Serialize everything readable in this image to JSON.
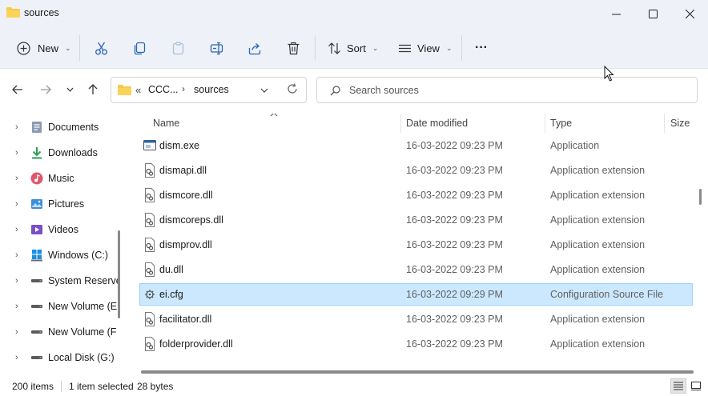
{
  "window": {
    "title": "sources",
    "minimize": "minimize",
    "maximize": "maximize",
    "close": "close"
  },
  "toolbar": {
    "new_label": "New",
    "sort_label": "Sort",
    "view_label": "View",
    "more_label": "···"
  },
  "address": {
    "overflow": "«",
    "crumbs": [
      "CCC...",
      "sources"
    ]
  },
  "search": {
    "placeholder": "Search sources"
  },
  "sidebar": {
    "items": [
      {
        "label": "Documents",
        "icon": "documents-icon"
      },
      {
        "label": "Downloads",
        "icon": "downloads-icon"
      },
      {
        "label": "Music",
        "icon": "music-icon"
      },
      {
        "label": "Pictures",
        "icon": "pictures-icon"
      },
      {
        "label": "Videos",
        "icon": "videos-icon"
      },
      {
        "label": "Windows (C:)",
        "icon": "windows-drive-icon"
      },
      {
        "label": "System Reserve",
        "icon": "drive-icon"
      },
      {
        "label": "New Volume (E",
        "icon": "drive-icon"
      },
      {
        "label": "New Volume (F",
        "icon": "drive-icon"
      },
      {
        "label": "Local Disk (G:)",
        "icon": "drive-icon"
      }
    ]
  },
  "columns": {
    "name": "Name",
    "date": "Date modified",
    "type": "Type",
    "size": "Size"
  },
  "files": [
    {
      "name": "dism.exe",
      "date": "16-03-2022 09:23 PM",
      "type": "Application",
      "icon": "exe-icon",
      "selected": false
    },
    {
      "name": "dismapi.dll",
      "date": "16-03-2022 09:23 PM",
      "type": "Application extension",
      "icon": "dll-icon",
      "selected": false
    },
    {
      "name": "dismcore.dll",
      "date": "16-03-2022 09:23 PM",
      "type": "Application extension",
      "icon": "dll-icon",
      "selected": false
    },
    {
      "name": "dismcoreps.dll",
      "date": "16-03-2022 09:23 PM",
      "type": "Application extension",
      "icon": "dll-icon",
      "selected": false
    },
    {
      "name": "dismprov.dll",
      "date": "16-03-2022 09:23 PM",
      "type": "Application extension",
      "icon": "dll-icon",
      "selected": false
    },
    {
      "name": "du.dll",
      "date": "16-03-2022 09:23 PM",
      "type": "Application extension",
      "icon": "dll-icon",
      "selected": false
    },
    {
      "name": "ei.cfg",
      "date": "16-03-2022 09:29 PM",
      "type": "Configuration Source File",
      "icon": "cfg-icon",
      "selected": true
    },
    {
      "name": "facilitator.dll",
      "date": "16-03-2022 09:23 PM",
      "type": "Application extension",
      "icon": "dll-icon",
      "selected": false
    },
    {
      "name": "folderprovider.dll",
      "date": "16-03-2022 09:23 PM",
      "type": "Application extension",
      "icon": "dll-icon",
      "selected": false
    }
  ],
  "status": {
    "count": "200 items",
    "selection": "1 item selected",
    "size": "28 bytes"
  },
  "colors": {
    "accent": "#0067c0",
    "selection_bg": "#cce8ff",
    "selection_border": "#99d1ff",
    "chrome_bg": "#eef2f8",
    "folder": "#f7c948"
  }
}
